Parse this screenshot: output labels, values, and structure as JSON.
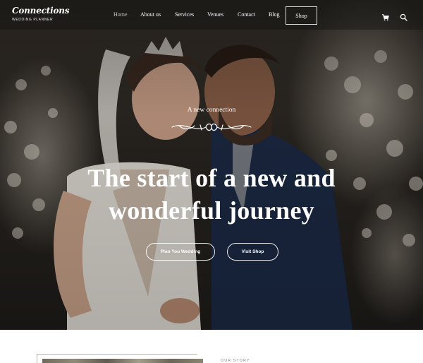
{
  "nav": {
    "logo": {
      "name": "Connections",
      "tagline": "WEDDING PLANNER"
    },
    "menu": [
      {
        "label": "Home",
        "active": true
      },
      {
        "label": "About us"
      },
      {
        "label": "Services"
      },
      {
        "label": "Venues"
      },
      {
        "label": "Contact"
      },
      {
        "label": "Blog"
      }
    ],
    "shop_label": "Shop",
    "icons": [
      "cart-icon",
      "search-icon"
    ]
  },
  "hero": {
    "eyebrow": "A new connection",
    "headline_line1": "The start of a new and",
    "headline_line2": "wonderful journey",
    "primary_cta": "Plan You Wedding",
    "secondary_cta": "Visit Shop"
  },
  "story": {
    "label": "OUR STORY"
  },
  "colors": {
    "overlay": "#141414",
    "text": "#ffffff",
    "active_link": "#c9c3bb"
  }
}
